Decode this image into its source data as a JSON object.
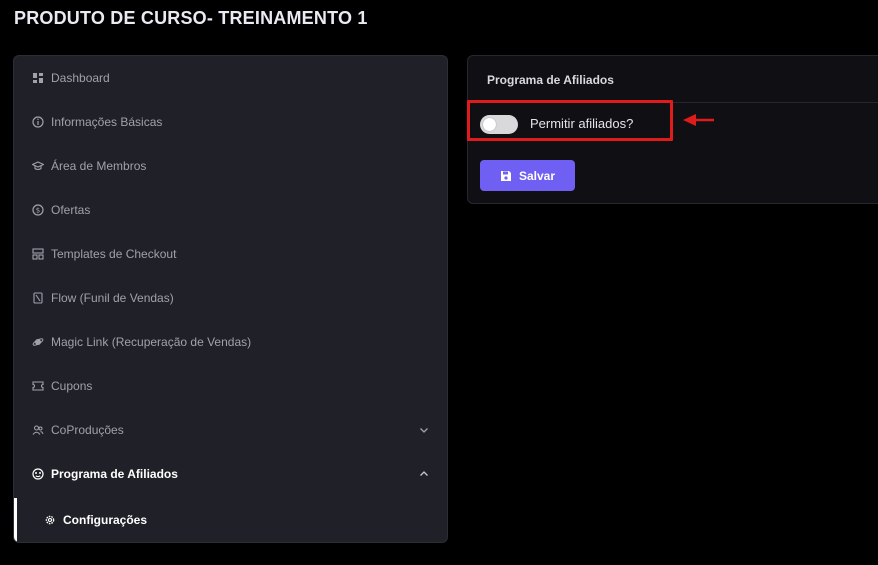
{
  "page": {
    "title": "PRODUTO DE CURSO- TREINAMENTO 1"
  },
  "sidebar": {
    "items": [
      {
        "label": "Dashboard",
        "icon": "dashboard-icon"
      },
      {
        "label": "Informações Básicas",
        "icon": "info-icon"
      },
      {
        "label": "Área de Membros",
        "icon": "graduation-cap-icon"
      },
      {
        "label": "Ofertas",
        "icon": "dollar-circle-icon"
      },
      {
        "label": "Templates de Checkout",
        "icon": "template-icon"
      },
      {
        "label": "Flow (Funil de Vendas)",
        "icon": "flow-icon"
      },
      {
        "label": "Magic Link (Recuperação de Vendas)",
        "icon": "planet-icon"
      },
      {
        "label": "Cupons",
        "icon": "coupon-icon"
      },
      {
        "label": "CoProduções",
        "icon": "users-icon",
        "chevron": "down"
      },
      {
        "label": "Programa de Afiliados",
        "icon": "affiliate-icon",
        "chevron": "up",
        "active": true
      }
    ],
    "sub_items": [
      {
        "label": "Configurações",
        "icon": "gear-icon",
        "active": true
      }
    ]
  },
  "panel": {
    "title": "Programa de Afiliados",
    "toggle_label": "Permitir afiliados?",
    "toggle_enabled": false,
    "save_label": "Salvar"
  },
  "colors": {
    "background": "#000000",
    "sidebar_bg": "#202128",
    "panel_bg": "#101014",
    "accent": "#6f5ff2",
    "highlight": "#e01b1b"
  }
}
